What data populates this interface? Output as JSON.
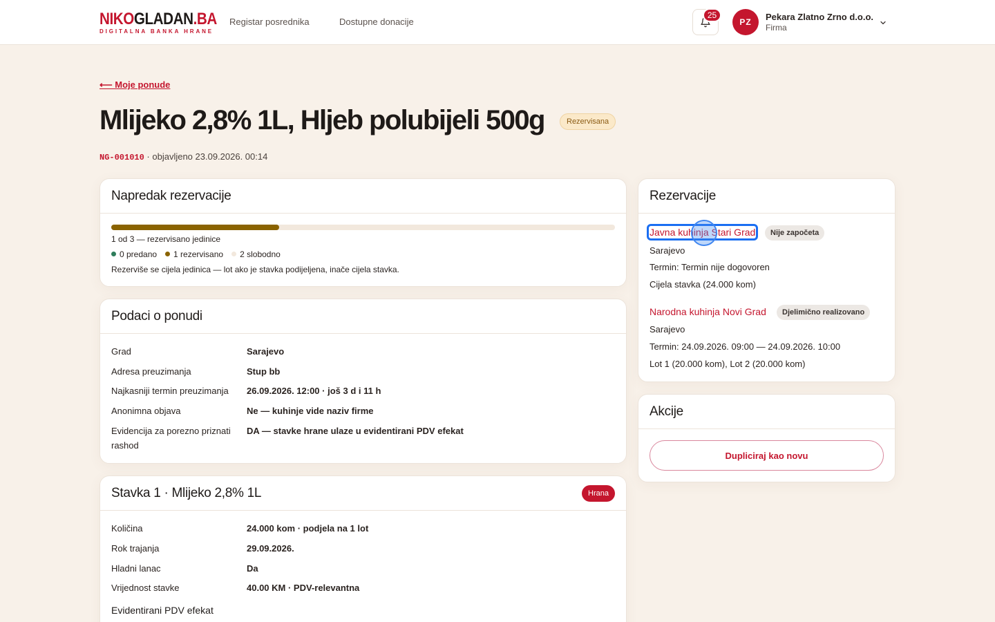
{
  "header": {
    "logo_text_a": "NIKO",
    "logo_text_b": "GLADAN",
    "logo_text_c": ".BA",
    "logo_subtitle": "DIGITALNA BANKA HRANE",
    "nav": [
      "Registar posrednika",
      "Dostupne donacije"
    ],
    "notifications_count": "25",
    "user": {
      "initials": "PZ",
      "name": "Pekara Zlatno Zrno d.o.o.",
      "role": "Firma"
    }
  },
  "page": {
    "back_label": "⟵ Moje ponude",
    "title": "Mlijeko 2,8% 1L, Hljeb polubijeli 500g",
    "status": "Rezervisana",
    "code": "NG-001010",
    "published": " · objavljeno 23.09.2026. 00:14"
  },
  "progress": {
    "title": "Napredak rezervacije",
    "fraction": 0.333,
    "summary": "1 od 3 — rezervisano jedinice",
    "legend": [
      {
        "label": "0 predano",
        "color": "#2e7d5b"
      },
      {
        "label": "1 rezervisano",
        "color": "#8a6300"
      },
      {
        "label": "2 slobodno",
        "color": "#f2e8dd"
      }
    ],
    "note": "Rezerviše se cijela jedinica — lot ako je stavka podijeljena, inače cijela stavka."
  },
  "offer": {
    "title": "Podaci o ponudi",
    "rows": [
      {
        "k": "Grad",
        "v": "Sarajevo"
      },
      {
        "k": "Adresa preuzimanja",
        "v": "Stup bb"
      },
      {
        "k": "Najkasniji termin preuzimanja",
        "v": "26.09.2026. 12:00 · još 3 d i 11 h"
      },
      {
        "k": "Anonimna objava",
        "v": "Ne — kuhinje vide naziv firme"
      },
      {
        "k": "Evidencija za porezno priznati rashod",
        "v": "DA — stavke hrane ulaze u evidentirani PDV efekat"
      }
    ]
  },
  "item1": {
    "title": "Stavka 1 · Mlijeko 2,8% 1L",
    "badge": "Hrana",
    "rows": [
      {
        "k": "Količina",
        "v": "24.000 kom · podjela na 1 lot"
      },
      {
        "k": "Rok trajanja",
        "v": "29.09.2026."
      },
      {
        "k": "Hladni lanac",
        "v": "Da"
      },
      {
        "k": "Vrijednost stavke",
        "v": "40.00 KM · PDV-relevantna"
      }
    ],
    "subheading": "Evidentirani PDV efekat"
  },
  "reservations": {
    "title": "Rezervacije",
    "items": [
      {
        "name": "Javna kuhinja Stari Grad",
        "status": "Nije započeta",
        "city": "Sarajevo",
        "term": "Termin: Termin nije dogovoren",
        "amount": "Cijela stavka (24.000 kom)"
      },
      {
        "name": "Narodna kuhinja Novi Grad",
        "status": "Djelimično realizovano",
        "city": "Sarajevo",
        "term": "Termin: 24.09.2026. 09:00 — 24.09.2026. 10:00",
        "amount": "Lot 1 (20.000 kom), Lot 2 (20.000 kom)"
      }
    ]
  },
  "actions": {
    "title": "Akcije",
    "duplicate_label": "Dupliciraj kao novu"
  }
}
